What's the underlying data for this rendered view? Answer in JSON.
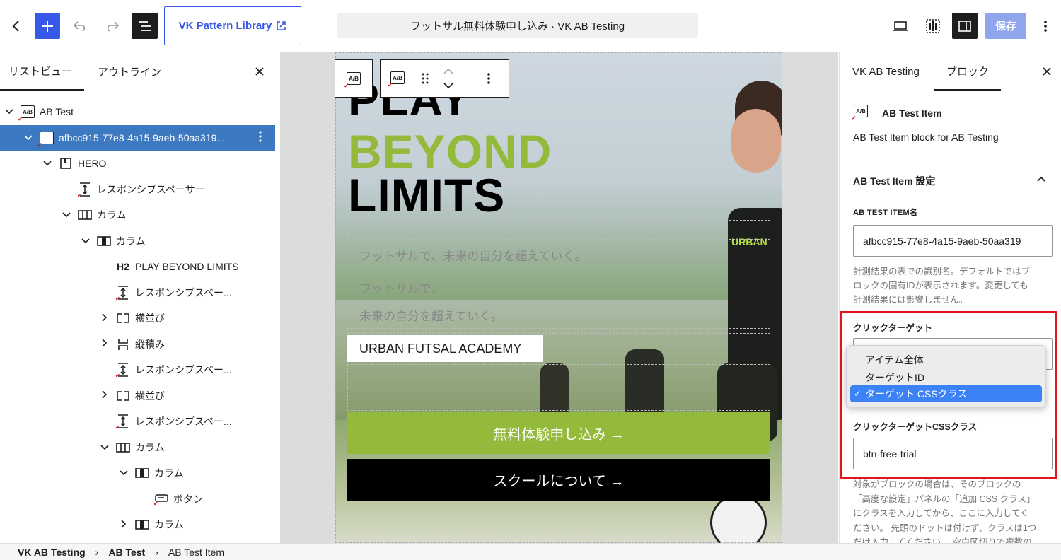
{
  "topbar": {
    "pattern_library": "VK Pattern Library",
    "doc_title": "フットサル無料体験申し込み · VK AB Testing",
    "save": "保存"
  },
  "left_panel": {
    "tabs": [
      "リストビュー",
      "アウトライン"
    ],
    "tree": [
      {
        "label": "AB Test",
        "depth": 0,
        "icon": "ab-test-icon",
        "chev": "down"
      },
      {
        "label": "afbcc915-77e8-4a15-9aeb-50aa319...",
        "depth": 1,
        "icon": "ab-test-icon",
        "chev": "down",
        "selected": true
      },
      {
        "label": "HERO",
        "depth": 2,
        "icon": "bookmark-icon",
        "chev": "down"
      },
      {
        "label": "レスポンシブスペーサー",
        "depth": 3,
        "icon": "spacer-icon"
      },
      {
        "label": "カラム",
        "depth": 3,
        "icon": "columns-icon",
        "chev": "down"
      },
      {
        "label": "カラム",
        "depth": 4,
        "icon": "column-icon",
        "chev": "down"
      },
      {
        "label": "PLAY BEYOND LIMITS",
        "depth": 5,
        "icon": "heading-icon"
      },
      {
        "label": "レスポンシブスペー...",
        "depth": 5,
        "icon": "spacer-icon"
      },
      {
        "label": "横並び",
        "depth": 5,
        "icon": "row-icon",
        "chev": "right"
      },
      {
        "label": "縦積み",
        "depth": 5,
        "icon": "stack-icon",
        "chev": "right"
      },
      {
        "label": "レスポンシブスペー...",
        "depth": 5,
        "icon": "spacer-icon"
      },
      {
        "label": "横並び",
        "depth": 5,
        "icon": "row-icon",
        "chev": "right"
      },
      {
        "label": "レスポンシブスペー...",
        "depth": 5,
        "icon": "spacer-icon"
      },
      {
        "label": "カラム",
        "depth": 5,
        "icon": "columns-icon",
        "chev": "down"
      },
      {
        "label": "カラム",
        "depth": 6,
        "icon": "column-icon",
        "chev": "down"
      },
      {
        "label": "ボタン",
        "depth": 7,
        "icon": "button-icon"
      },
      {
        "label": "カラム",
        "depth": 6,
        "icon": "column-icon",
        "chev": "right"
      },
      {
        "label": "カラム",
        "depth": 5,
        "icon": "columns-icon"
      }
    ]
  },
  "canvas": {
    "heading_line1": "PLAY",
    "heading_line2": "BEYOND",
    "heading_line3": "LIMITS",
    "sub1": "フットサルで、未来の自分を超えていく。",
    "sub2a": "フットサルで、",
    "sub2b": "未来の自分を超えていく。",
    "academy": "URBAN FUTSAL ACADEMY",
    "btn_trial": "無料体験申し込み →",
    "btn_about": "スクールについて →",
    "jersey_text": "URBAN",
    "accent_color": "#94ba3c"
  },
  "right_panel": {
    "tabs": [
      "VK AB Testing",
      "ブロック"
    ],
    "block_name": "AB Test Item",
    "block_desc": "AB Test Item block for AB Testing",
    "section_title": "AB Test Item 設定",
    "item_name_label": "AB TEST ITEM名",
    "item_name_value": "afbcc915-77e8-4a15-9aeb-50aa319",
    "help1a": "計測結果の表での識別名。デフォルトではブ",
    "help1b": "ロックの固有IDが表示されます。変更しても",
    "help1c": "計測結果には影響しません。",
    "click_target_label": "クリックターゲット",
    "options": [
      "アイテム全体",
      "ターゲットID",
      "ターゲット CSSクラス"
    ],
    "selected_option": "ターゲット CSSクラス",
    "css_class_label": "クリックターゲットCSSクラス",
    "css_class_value": "btn-free-trial",
    "help2a": "対象がブロックの場合は、そのブロックの",
    "help2b": "「高度な設定」パネルの「追加 CSS クラス」",
    "help2c": "にクラスを入力してから、ここに入力してく",
    "help2d": "ださい。 先頭のドットは付けず、クラスは1つ",
    "help2e": "だけ入力してください。 空白区切りで複数の"
  },
  "breadcrumb": [
    "VK AB Testing",
    "AB Test",
    "AB Test Item"
  ]
}
